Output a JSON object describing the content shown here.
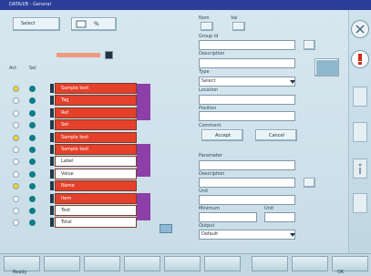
{
  "window": {
    "title": "DATA/I/B - General"
  },
  "header": {
    "left_button_label": "Select",
    "right_button_label": "%"
  },
  "left_panel": {
    "filter_field": "",
    "col1_label": "Act",
    "col2_label": "Sel",
    "rows": [
      {
        "text": "Sample text",
        "style": "red"
      },
      {
        "text": "Tag",
        "style": "red"
      },
      {
        "text": "Ref",
        "style": "red"
      },
      {
        "text": "Set",
        "style": "red"
      },
      {
        "text": "Sample text",
        "style": "red"
      },
      {
        "text": "Sample text",
        "style": "red"
      },
      {
        "text": "Label",
        "style": "white"
      },
      {
        "text": "Value",
        "style": "white"
      },
      {
        "text": "Name",
        "style": "red"
      },
      {
        "text": "Item",
        "style": "red"
      },
      {
        "text": "Text",
        "style": "white"
      },
      {
        "text": "Total",
        "style": "white"
      }
    ]
  },
  "right_panel": {
    "top_labels": [
      "Nom",
      "Val"
    ],
    "fields_a": [
      {
        "label": "Group Id",
        "value": ""
      },
      {
        "label": "Description",
        "value": ""
      },
      {
        "label": "Type",
        "value": "Select"
      },
      {
        "label": "Location",
        "value": ""
      },
      {
        "label": "Position",
        "value": ""
      },
      {
        "label": "Comment",
        "value": ""
      }
    ],
    "mid_buttons": [
      "Accept",
      "Cancel"
    ],
    "fields_b": [
      {
        "label": "Parameter",
        "value": ""
      },
      {
        "label": "Description",
        "value": ""
      },
      {
        "label": "Unit",
        "value": ""
      },
      {
        "label": "Minimum",
        "value": ""
      }
    ],
    "small_labels": [
      "Limit value",
      "Unit"
    ],
    "last_label": "Output",
    "last_field": "Default"
  },
  "status_bar": {
    "left": "Ready",
    "right": "OK"
  },
  "icons": {
    "warning": "warning-icon",
    "close": "close-icon",
    "info": "info-icon"
  },
  "colors": {
    "window_title": "#2b3f9a",
    "accent_red": "#e4402a",
    "accent_purple": "#8c3fa6",
    "led_teal": "#0e7c86",
    "led_yellow": "#f2d02a"
  }
}
